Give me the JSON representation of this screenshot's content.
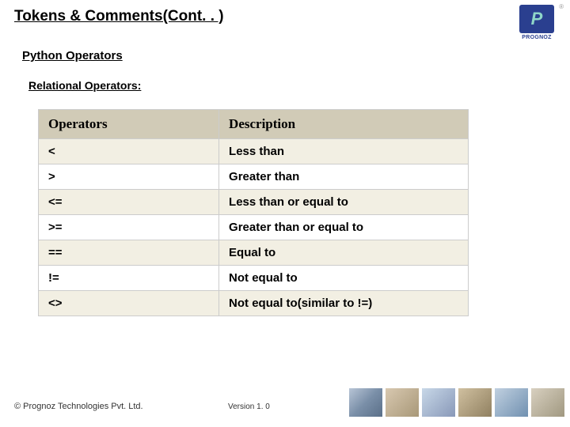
{
  "title": "Tokens & Comments(Cont. . )",
  "subtitle1": "Python Operators",
  "subtitle2": "Relational Operators:",
  "logo": {
    "initial": "P",
    "name": "PROGNOZ",
    "reg": "®"
  },
  "table": {
    "headers": {
      "col1": "Operators",
      "col2": "Description"
    },
    "rows": [
      {
        "op": "<",
        "desc": "Less than"
      },
      {
        "op": ">",
        "desc": "Greater than"
      },
      {
        "op": "<=",
        "desc": "Less than or equal to"
      },
      {
        "op": ">=",
        "desc": "Greater than or equal to"
      },
      {
        "op": "==",
        "desc": "Equal to"
      },
      {
        "op": "!=",
        "desc": "Not equal to"
      },
      {
        "op": "<>",
        "desc": "Not equal to(similar to !=)"
      }
    ]
  },
  "footer": {
    "copyright": "© Prognoz Technologies Pvt. Ltd.",
    "version": "Version 1. 0"
  }
}
